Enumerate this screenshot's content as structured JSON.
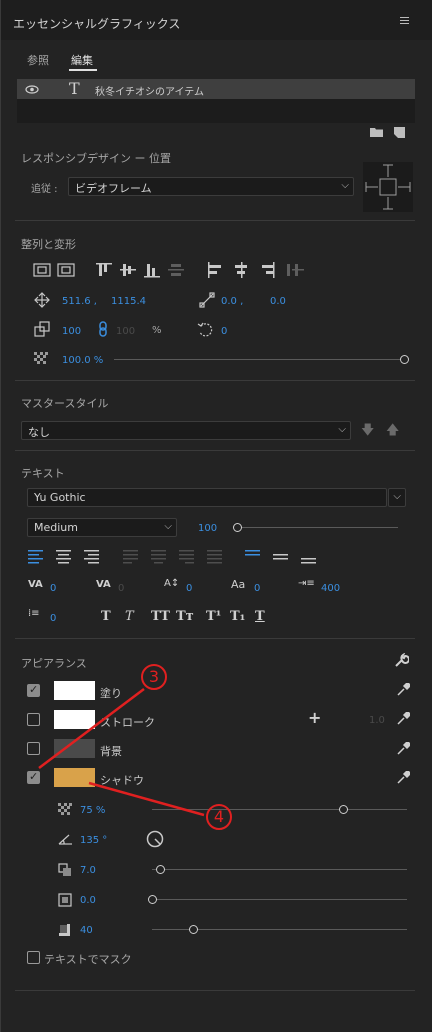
{
  "panel": {
    "title": "エッセンシャルグラフィックス"
  },
  "tabs": [
    {
      "label": "参照",
      "active": false
    },
    {
      "label": "編集",
      "active": true
    }
  ],
  "layer": {
    "name": "秋冬イチオシのアイテム",
    "type_glyph": "T"
  },
  "responsive": {
    "title": "レスポンシブデザイン ー 位置",
    "follow_label": "追従 :",
    "follow_value": "ビデオフレーム"
  },
  "align": {
    "title": "整列と変形",
    "position_x": "511.6 ,",
    "position_y": "1115.4",
    "anchor_x": "0.0 ,",
    "anchor_y": "0.0",
    "scale": "100",
    "scale_h": "100",
    "percent": "%",
    "rotation": "0",
    "opacity": "100.0 %",
    "opacity_level": 1.0
  },
  "master_style": {
    "title": "マスタースタイル",
    "value": "なし"
  },
  "text": {
    "title": "テキスト",
    "font": "Yu Gothic",
    "weight": "Medium",
    "size": "100",
    "kerning": "0",
    "tracking": "0",
    "baseline": "0",
    "tsume": "0",
    "leading": "400",
    "indent": "0",
    "style_buttons": [
      "T",
      "T",
      "TT",
      "Tт",
      "T¹",
      "T₁",
      "T"
    ]
  },
  "appearance": {
    "title": "アピアランス",
    "fill": {
      "label": "塗り",
      "checked": true,
      "color": "#ffffff"
    },
    "stroke": {
      "label": "ストローク",
      "checked": false,
      "color": "#ffffff",
      "width": "1.0"
    },
    "background": {
      "label": "背景",
      "checked": false,
      "color": "#4a4a4a"
    },
    "shadow": {
      "label": "シャドウ",
      "checked": true,
      "color": "#d9a24a"
    },
    "shadow_opacity": "75 %",
    "shadow_opacity_level": 0.75,
    "shadow_angle": "135 °",
    "shadow_distance": "7.0",
    "shadow_distance_level": 0.03,
    "shadow_size": "0.0",
    "shadow_size_level": 0.0,
    "shadow_blur": "40",
    "shadow_blur_level": 0.16,
    "mask_label": "テキストでマスク"
  },
  "annotations": {
    "three": "3",
    "four": "4"
  },
  "colors": {
    "accent": "#3b8fe0",
    "annotation": "#e02020",
    "panel_bg": "#232323"
  },
  "icons": [
    "menu-icon",
    "eye-icon",
    "folder-icon",
    "new-item-icon",
    "wrench-icon",
    "eyedropper-icon",
    "plus-icon",
    "link-icon",
    "rotate-icon",
    "angle-dial-icon"
  ]
}
